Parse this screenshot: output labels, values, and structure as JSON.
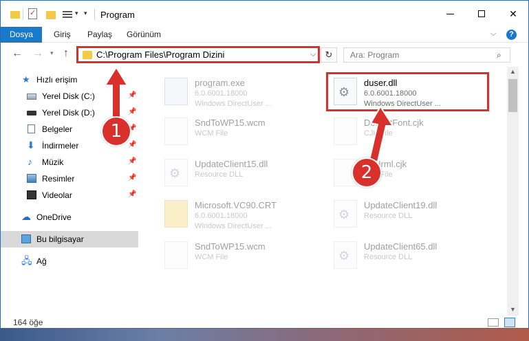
{
  "window": {
    "title": "Program"
  },
  "ribbon": {
    "tabs": [
      {
        "label": "Dosya"
      },
      {
        "label": "Giriş"
      },
      {
        "label": "Paylaş"
      },
      {
        "label": "Görünüm"
      }
    ],
    "help": "?"
  },
  "nav": {
    "address": "C:\\Program Files\\Program Dizini",
    "search_placeholder": "Ara: Program"
  },
  "sidebar": {
    "items": [
      {
        "label": "Hızlı erişim",
        "icon": "star-icon"
      },
      {
        "label": "Yerel Disk (C:)",
        "icon": "drive-icon",
        "pinned": true
      },
      {
        "label": "Yerel Disk (D:)",
        "icon": "drive-icon",
        "pinned": true
      },
      {
        "label": "Belgeler",
        "icon": "documents-icon",
        "pinned": true
      },
      {
        "label": "İndirmeler",
        "icon": "download-icon",
        "pinned": true
      },
      {
        "label": "Müzik",
        "icon": "music-icon",
        "pinned": true
      },
      {
        "label": "Resimler",
        "icon": "pictures-icon",
        "pinned": true
      },
      {
        "label": "Videolar",
        "icon": "videos-icon",
        "pinned": true
      },
      {
        "label": "OneDrive",
        "icon": "cloud-icon"
      },
      {
        "label": "Bu bilgisayar",
        "icon": "computer-icon",
        "selected": true
      },
      {
        "label": "Ağ",
        "icon": "network-icon"
      }
    ]
  },
  "files": [
    {
      "name": "program.exe",
      "line1": "6.0.6001.18000",
      "line2": "Windows DirectUser ...",
      "type": "exe"
    },
    {
      "name": "duser.dll",
      "line1": "6.0.6001.18000",
      "line2": "Windows DirectUser ...",
      "type": "dll"
    },
    {
      "name": "SndToWP15.wcm",
      "line1": "WCM File",
      "line2": "",
      "type": "file"
    },
    {
      "name": "DefaultFont.cjk",
      "line1": "CJK File",
      "line2": "",
      "type": "file"
    },
    {
      "name": "UpdateClient15.dll",
      "line1": "Resource DLL",
      "line2": "",
      "type": "dll"
    },
    {
      "name": "AsNrml.cjk",
      "line1": "CJK File",
      "line2": "",
      "type": "file"
    },
    {
      "name": "Microsoft.VC90.CRT",
      "line1": "6.0.6001.18000",
      "line2": "Windows DirectUser ...",
      "type": "folder"
    },
    {
      "name": "UpdateClient19.dll",
      "line1": "Resource DLL",
      "line2": "",
      "type": "dll"
    },
    {
      "name": "SndToWP15.wcm",
      "line1": "WCM File",
      "line2": "",
      "type": "file"
    },
    {
      "name": "UpdateClient65.dll",
      "line1": "Resource DLL",
      "line2": "",
      "type": "dll"
    }
  ],
  "status": {
    "count": "164 öğe"
  },
  "callouts": {
    "one": "1",
    "two": "2"
  },
  "colors": {
    "accent": "#1979ca",
    "highlight": "#d9302c",
    "folder": "#f3c948"
  }
}
